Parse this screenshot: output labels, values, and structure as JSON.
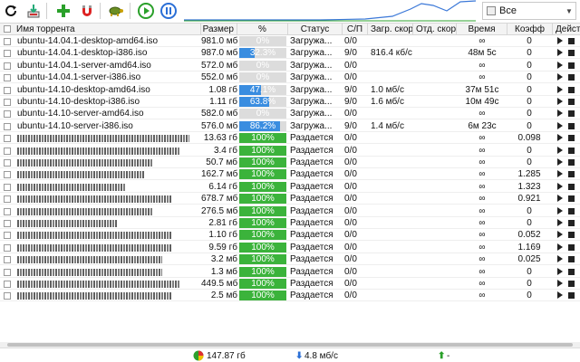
{
  "toolbar": {
    "buttons": [
      {
        "name": "refresh",
        "icon": "refresh-icon"
      },
      {
        "name": "add-file",
        "icon": "add-file-icon"
      },
      {
        "name": "add-torrent",
        "icon": "plus-icon"
      },
      {
        "name": "magnet",
        "icon": "magnet-icon"
      },
      {
        "name": "turtle-mode",
        "icon": "turtle-icon"
      },
      {
        "name": "start-all",
        "icon": "play-circle-icon"
      },
      {
        "name": "pause-all",
        "icon": "pause-circle-icon"
      }
    ],
    "filter": {
      "selected": "Все"
    }
  },
  "colors": {
    "progress_blue": "#3a8de0",
    "progress_green": "#3bb33b",
    "graph_line": "#3b78d8",
    "graph_green": "#2ca02c"
  },
  "table": {
    "columns": [
      "Имя торрента",
      "Размер",
      "%",
      "Статус",
      "С/П",
      "Загр. скор",
      "Отд. скор",
      "Время",
      "Коэфф",
      "Дейст"
    ],
    "rows": [
      {
        "name": "ubuntu-14.04.1-desktop-amd64.iso",
        "size": "981.0 мб",
        "pct": "0%",
        "progress": 0,
        "status": "Загружа...",
        "sp": "0/0",
        "down": "",
        "up": "",
        "time": "∞",
        "ratio": "0",
        "blurred": false
      },
      {
        "name": "ubuntu-14.04.1-desktop-i386.iso",
        "size": "987.0 мб",
        "pct": "32.3%",
        "progress": 0.323,
        "status": "Загружа...",
        "sp": "9/0",
        "down": "816.4 кб/с",
        "up": "",
        "time": "48м 5с",
        "ratio": "0",
        "blurred": false
      },
      {
        "name": "ubuntu-14.04.1-server-amd64.iso",
        "size": "572.0 мб",
        "pct": "0%",
        "progress": 0,
        "status": "Загружа...",
        "sp": "0/0",
        "down": "",
        "up": "",
        "time": "∞",
        "ratio": "0",
        "blurred": false
      },
      {
        "name": "ubuntu-14.04.1-server-i386.iso",
        "size": "552.0 мб",
        "pct": "0%",
        "progress": 0,
        "status": "Загружа...",
        "sp": "0/0",
        "down": "",
        "up": "",
        "time": "∞",
        "ratio": "0",
        "blurred": false
      },
      {
        "name": "ubuntu-14.10-desktop-amd64.iso",
        "size": "1.08 гб",
        "pct": "47.1%",
        "progress": 0.471,
        "status": "Загружа...",
        "sp": "9/0",
        "down": "1.0 мб/с",
        "up": "",
        "time": "37м 51с",
        "ratio": "0",
        "blurred": false
      },
      {
        "name": "ubuntu-14.10-desktop-i386.iso",
        "size": "1.11 гб",
        "pct": "63.8%",
        "progress": 0.638,
        "status": "Загружа...",
        "sp": "9/0",
        "down": "1.6 мб/с",
        "up": "",
        "time": "10м 49с",
        "ratio": "0",
        "blurred": false
      },
      {
        "name": "ubuntu-14.10-server-amd64.iso",
        "size": "582.0 мб",
        "pct": "0%",
        "progress": 0,
        "status": "Загружа...",
        "sp": "0/0",
        "down": "",
        "up": "",
        "time": "∞",
        "ratio": "0",
        "blurred": false
      },
      {
        "name": "ubuntu-14.10-server-i386.iso",
        "size": "576.0 мб",
        "pct": "86.2%",
        "progress": 0.862,
        "status": "Загружа...",
        "sp": "9/0",
        "down": "1.4 мб/с",
        "up": "",
        "time": "6м 23с",
        "ratio": "0",
        "blurred": false
      },
      {
        "name": "",
        "size": "13.63 гб",
        "pct": "100%",
        "progress": 1,
        "status": "Раздается",
        "sp": "0/0",
        "down": "",
        "up": "",
        "time": "∞",
        "ratio": "0.098",
        "blurred": true
      },
      {
        "name": "",
        "size": "3.4 гб",
        "pct": "100%",
        "progress": 1,
        "status": "Раздается",
        "sp": "0/0",
        "down": "",
        "up": "",
        "time": "∞",
        "ratio": "0",
        "blurred": true
      },
      {
        "name": "",
        "size": "50.7 мб",
        "pct": "100%",
        "progress": 1,
        "status": "Раздается",
        "sp": "0/0",
        "down": "",
        "up": "",
        "time": "∞",
        "ratio": "0",
        "blurred": true
      },
      {
        "name": "",
        "size": "162.7 мб",
        "pct": "100%",
        "progress": 1,
        "status": "Раздается",
        "sp": "0/0",
        "down": "",
        "up": "",
        "time": "∞",
        "ratio": "1.285",
        "blurred": true
      },
      {
        "name": "",
        "size": "6.14 гб",
        "pct": "100%",
        "progress": 1,
        "status": "Раздается",
        "sp": "0/0",
        "down": "",
        "up": "",
        "time": "∞",
        "ratio": "1.323",
        "blurred": true
      },
      {
        "name": "",
        "size": "678.7 мб",
        "pct": "100%",
        "progress": 1,
        "status": "Раздается",
        "sp": "0/0",
        "down": "",
        "up": "",
        "time": "∞",
        "ratio": "0.921",
        "blurred": true
      },
      {
        "name": "",
        "size": "276.5 мб",
        "pct": "100%",
        "progress": 1,
        "status": "Раздается",
        "sp": "0/0",
        "down": "",
        "up": "",
        "time": "∞",
        "ratio": "0",
        "blurred": true
      },
      {
        "name": "",
        "size": "2.81 гб",
        "pct": "100%",
        "progress": 1,
        "status": "Раздается",
        "sp": "0/0",
        "down": "",
        "up": "",
        "time": "∞",
        "ratio": "0",
        "blurred": true
      },
      {
        "name": "",
        "size": "1.10 гб",
        "pct": "100%",
        "progress": 1,
        "status": "Раздается",
        "sp": "0/0",
        "down": "",
        "up": "",
        "time": "∞",
        "ratio": "0.052",
        "blurred": true
      },
      {
        "name": "",
        "size": "9.59 гб",
        "pct": "100%",
        "progress": 1,
        "status": "Раздается",
        "sp": "0/0",
        "down": "",
        "up": "",
        "time": "∞",
        "ratio": "1.169",
        "blurred": true
      },
      {
        "name": "",
        "size": "3.2 мб",
        "pct": "100%",
        "progress": 1,
        "status": "Раздается",
        "sp": "0/0",
        "down": "",
        "up": "",
        "time": "∞",
        "ratio": "0.025",
        "blurred": true
      },
      {
        "name": "",
        "size": "1.3 мб",
        "pct": "100%",
        "progress": 1,
        "status": "Раздается",
        "sp": "0/0",
        "down": "",
        "up": "",
        "time": "∞",
        "ratio": "0",
        "blurred": true
      },
      {
        "name": "",
        "size": "449.5 мб",
        "pct": "100%",
        "progress": 1,
        "status": "Раздается",
        "sp": "0/0",
        "down": "",
        "up": "",
        "time": "∞",
        "ratio": "0",
        "blurred": true
      },
      {
        "name": "",
        "size": "2.5 мб",
        "pct": "100%",
        "progress": 1,
        "status": "Раздается",
        "sp": "0/0",
        "down": "",
        "up": "",
        "time": "∞",
        "ratio": "0",
        "blurred": true
      }
    ]
  },
  "statusbar": {
    "disk": "147.87 гб",
    "down": "4.8 мб/с",
    "up": "-"
  }
}
